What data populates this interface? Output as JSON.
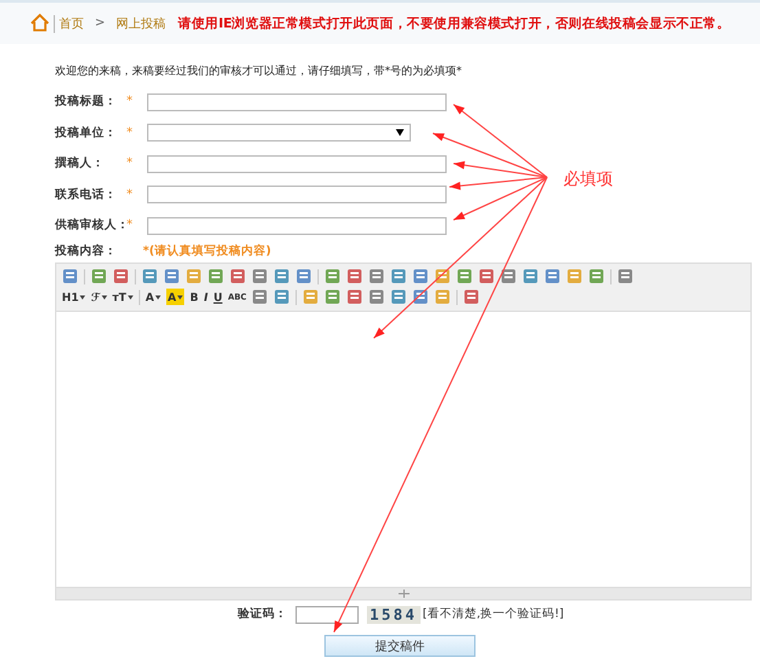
{
  "breadcrumb": [
    {
      "label": "首页"
    },
    {
      "label": ">"
    },
    {
      "label": "网上投稿"
    }
  ],
  "notice": "请使用IE浏览器正常模式打开此页面，不要使用兼容模式打开，否则在线投稿会显示不正常。",
  "intro": "欢迎您的来稿，来稿要经过我们的审核才可以通过，请仔细填写，带*号的为必填项*",
  "fields": [
    {
      "label": "投稿标题：",
      "required": "*",
      "kind": "text"
    },
    {
      "label": "投稿单位：",
      "required": "*",
      "kind": "select"
    },
    {
      "label": "撰稿人：",
      "required": "*",
      "kind": "text"
    },
    {
      "label": "联系电话：",
      "required": "*",
      "kind": "text"
    },
    {
      "label": "供稿审核人：",
      "required": "*",
      "kind": "text"
    }
  ],
  "content": {
    "label": "投稿内容：",
    "hint": "*(请认真填写投稿内容)"
  },
  "toolbar_rows": [
    [
      {
        "kind": "icon"
      },
      {
        "kind": "sep"
      },
      {
        "kind": "icon"
      },
      {
        "kind": "icon"
      },
      {
        "kind": "sep"
      },
      {
        "kind": "icon"
      },
      {
        "kind": "icon"
      },
      {
        "kind": "icon"
      },
      {
        "kind": "icon"
      },
      {
        "kind": "icon"
      },
      {
        "kind": "icon"
      },
      {
        "kind": "icon"
      },
      {
        "kind": "icon"
      },
      {
        "kind": "sep"
      },
      {
        "kind": "icon"
      },
      {
        "kind": "icon"
      },
      {
        "kind": "icon"
      },
      {
        "kind": "icon"
      },
      {
        "kind": "icon"
      },
      {
        "kind": "icon"
      },
      {
        "kind": "icon"
      },
      {
        "kind": "icon"
      },
      {
        "kind": "icon"
      },
      {
        "kind": "icon"
      },
      {
        "kind": "icon"
      },
      {
        "kind": "icon"
      },
      {
        "kind": "icon"
      },
      {
        "kind": "sep"
      },
      {
        "kind": "icon"
      }
    ],
    [
      {
        "kind": "menu",
        "label": "H1"
      },
      {
        "kind": "menu",
        "label": "ℱ"
      },
      {
        "kind": "menu",
        "label": "тT"
      },
      {
        "kind": "sep"
      },
      {
        "kind": "menu",
        "label": "A"
      },
      {
        "kind": "highlight",
        "label": "A"
      },
      {
        "kind": "text",
        "label": "B"
      },
      {
        "kind": "text",
        "label": "I"
      },
      {
        "kind": "text",
        "label": "U"
      },
      {
        "kind": "text",
        "label": "ABC"
      },
      {
        "kind": "icon"
      },
      {
        "kind": "icon"
      },
      {
        "kind": "sep"
      },
      {
        "kind": "icon"
      },
      {
        "kind": "icon"
      },
      {
        "kind": "icon"
      },
      {
        "kind": "icon"
      },
      {
        "kind": "icon"
      },
      {
        "kind": "icon"
      },
      {
        "kind": "icon"
      },
      {
        "kind": "sep"
      },
      {
        "kind": "icon"
      }
    ]
  ],
  "captcha": {
    "label": "验证码：",
    "code": "1584",
    "refresh": "[看不清楚,换一个验证码!]"
  },
  "submit": "提交稿件",
  "annotation": {
    "label": "必填项"
  }
}
